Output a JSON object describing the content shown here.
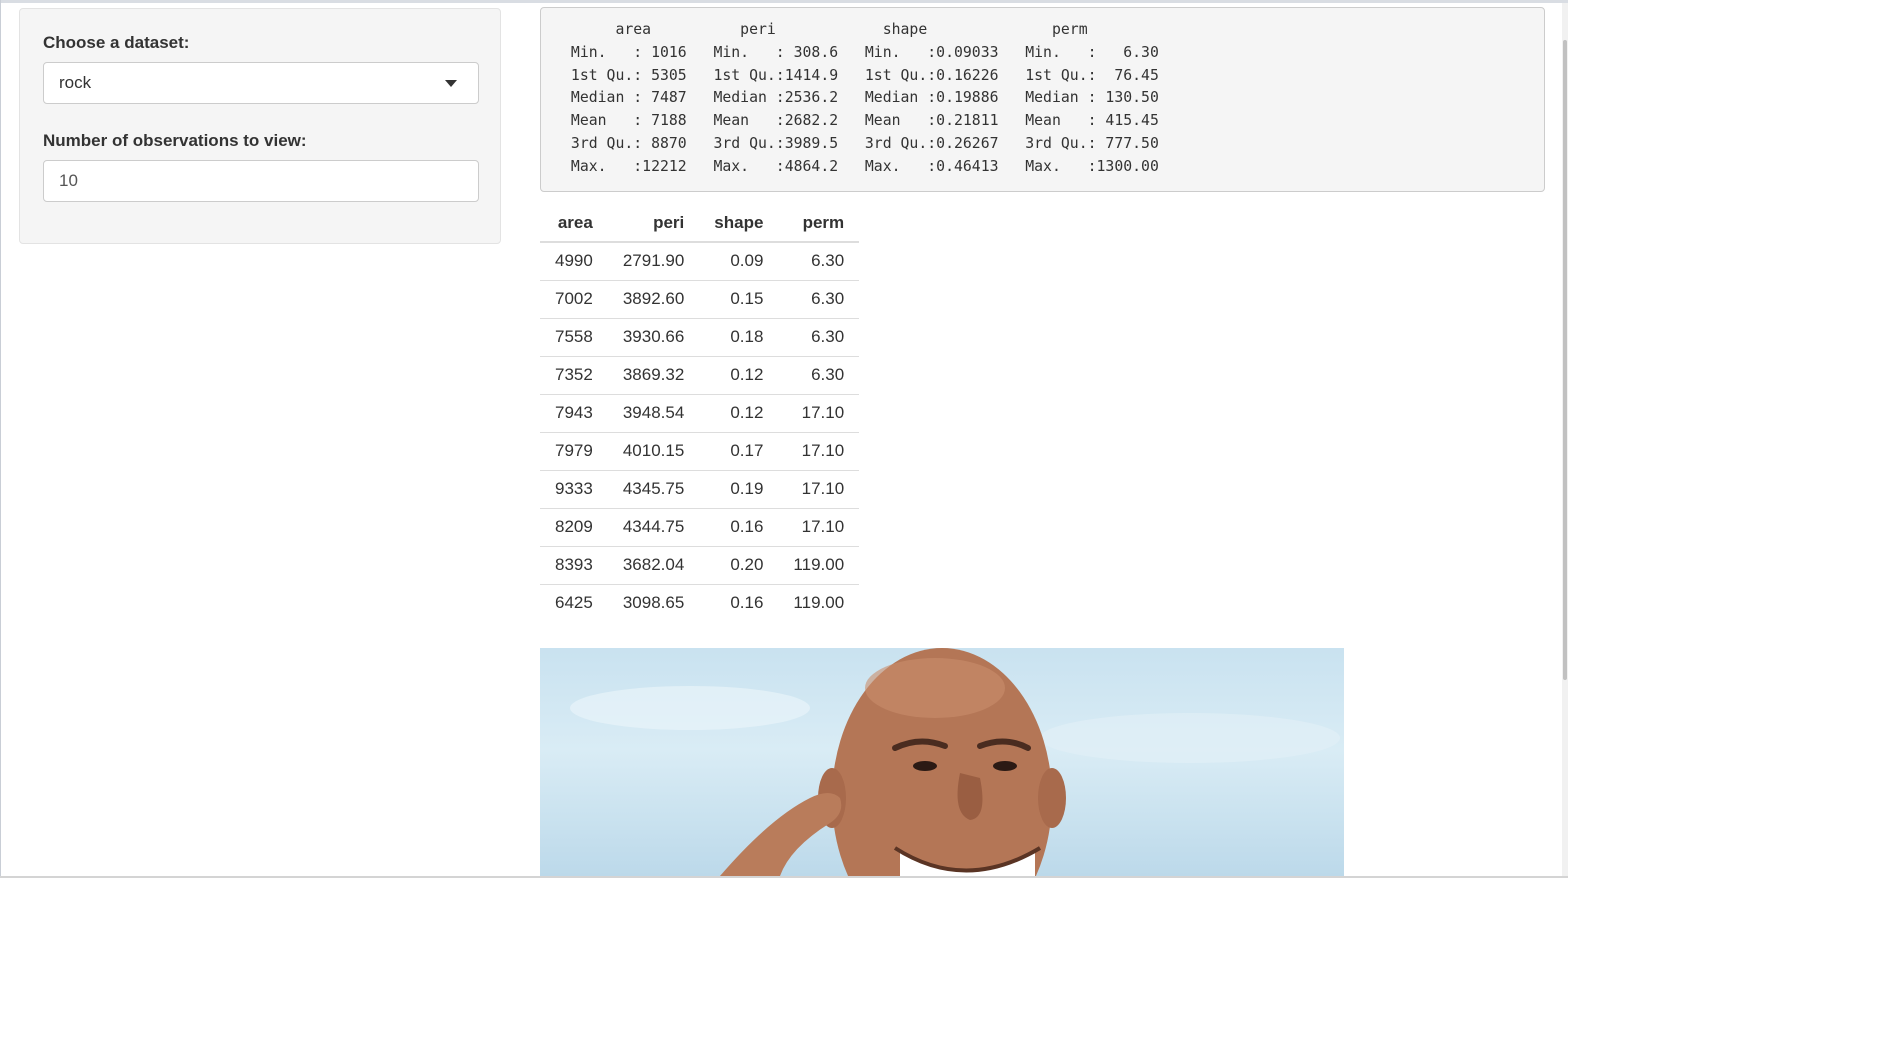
{
  "sidebar": {
    "dataset_label": "Choose a dataset:",
    "dataset_selected": "rock",
    "obs_label": "Number of observations to view:",
    "obs_value": "10"
  },
  "summary": {
    "lines": [
      "      area          peri            shape              perm        ",
      " Min.   : 1016   Min.   : 308.6   Min.   :0.09033   Min.   :   6.30  ",
      " 1st Qu.: 5305   1st Qu.:1414.9   1st Qu.:0.16226   1st Qu.:  76.45  ",
      " Median : 7487   Median :2536.2   Median :0.19886   Median : 130.50  ",
      " Mean   : 7188   Mean   :2682.2   Mean   :0.21811   Mean   : 415.45  ",
      " 3rd Qu.: 8870   3rd Qu.:3989.5   3rd Qu.:0.26267   3rd Qu.: 777.50  ",
      " Max.   :12212   Max.   :4864.2   Max.   :0.46413   Max.   :1300.00  "
    ]
  },
  "table": {
    "headers": [
      "area",
      "peri",
      "shape",
      "perm"
    ],
    "rows": [
      [
        "4990",
        "2791.90",
        "0.09",
        "6.30"
      ],
      [
        "7002",
        "3892.60",
        "0.15",
        "6.30"
      ],
      [
        "7558",
        "3930.66",
        "0.18",
        "6.30"
      ],
      [
        "7352",
        "3869.32",
        "0.12",
        "6.30"
      ],
      [
        "7943",
        "3948.54",
        "0.12",
        "17.10"
      ],
      [
        "7979",
        "4010.15",
        "0.17",
        "17.10"
      ],
      [
        "9333",
        "4345.75",
        "0.19",
        "17.10"
      ],
      [
        "8209",
        "4344.75",
        "0.16",
        "17.10"
      ],
      [
        "8393",
        "3682.04",
        "0.20",
        "119.00"
      ],
      [
        "6425",
        "3098.65",
        "0.16",
        "119.00"
      ]
    ]
  },
  "colors": {
    "panel_bg": "#f5f5f5",
    "border": "#cccccc",
    "text": "#333333",
    "sky": "#c9e2f0",
    "skin": "#b87a5a"
  },
  "icons": {
    "dropdown": "caret-down-icon"
  }
}
